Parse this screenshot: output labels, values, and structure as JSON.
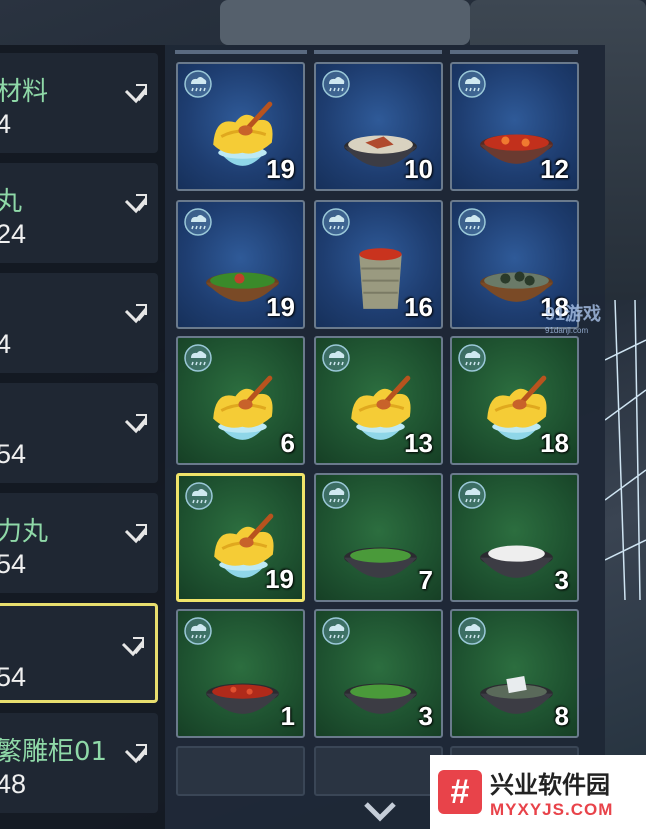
{
  "materials_list": {
    "items": [
      {
        "name": "材料",
        "count": "4",
        "selected": false
      },
      {
        "name": "丸",
        "count": "24",
        "selected": false
      },
      {
        "name": "",
        "count": "4",
        "selected": false
      },
      {
        "name": "",
        "count": "54",
        "selected": false
      },
      {
        "name": "力丸",
        "count": "54",
        "selected": false
      },
      {
        "name": "",
        "count": "54",
        "selected": true
      },
      {
        "name": "繁雕柜01",
        "count": "48",
        "selected": false
      }
    ]
  },
  "inventory": {
    "slots": [
      {
        "color": "blue",
        "food": "yellow-noodle-bowl",
        "qty": "19"
      },
      {
        "color": "blue",
        "food": "meat-soup-bowl",
        "qty": "10"
      },
      {
        "color": "blue",
        "food": "red-stew-bowl",
        "qty": "12"
      },
      {
        "color": "blue",
        "food": "green-veg-bowl",
        "qty": "19"
      },
      {
        "color": "blue",
        "food": "red-soup-cup",
        "qty": "16"
      },
      {
        "color": "blue",
        "food": "dumpling-soup-bowl",
        "qty": "18"
      },
      {
        "color": "green",
        "food": "yellow-noodle-bowl",
        "qty": "6"
      },
      {
        "color": "green",
        "food": "yellow-noodle-bowl",
        "qty": "13"
      },
      {
        "color": "green",
        "food": "yellow-noodle-bowl",
        "qty": "18"
      },
      {
        "color": "green",
        "food": "yellow-noodle-bowl",
        "qty": "19",
        "selected": true
      },
      {
        "color": "green",
        "food": "green-soup-bowl",
        "qty": "7"
      },
      {
        "color": "green",
        "food": "rice-bowl",
        "qty": "3"
      },
      {
        "color": "green",
        "food": "red-bean-bowl",
        "qty": "1"
      },
      {
        "color": "green",
        "food": "green-soup-bowl",
        "qty": "3"
      },
      {
        "color": "green",
        "food": "tofu-bowl",
        "qty": "8"
      }
    ]
  },
  "watermark": {
    "brand_cn": "游戏",
    "brand_num": "91",
    "url": "91danji.com"
  },
  "site_badge": {
    "logo": "#",
    "name": "兴业软件园",
    "url": "MYXYJS.COM"
  },
  "colors": {
    "selected_border": "#f0e46a",
    "blue_slot": "#1e3d70",
    "green_slot": "#1e5230"
  }
}
